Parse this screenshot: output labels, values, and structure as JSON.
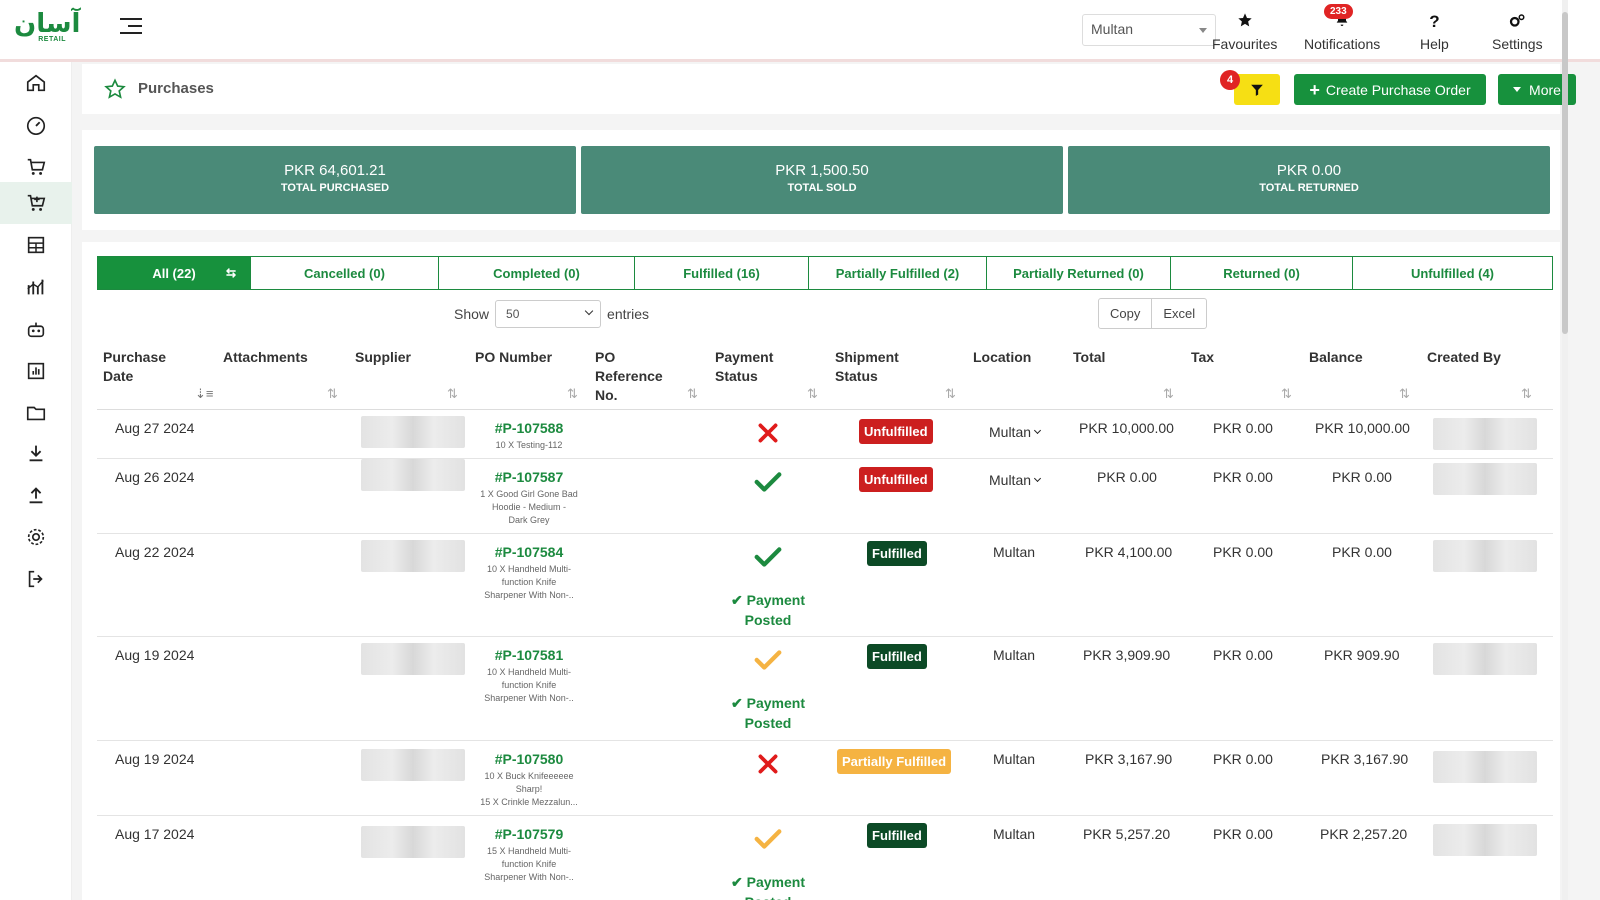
{
  "app": {
    "logo_text": "آسان",
    "logo_sub": "RETAIL"
  },
  "topbar": {
    "location_value": "Multan",
    "nav": [
      {
        "label": "Favourites",
        "icon": "star-icon"
      },
      {
        "label": "Notifications",
        "icon": "bell-icon",
        "badge": "233"
      },
      {
        "label": "Help",
        "icon": "question-icon"
      },
      {
        "label": "Settings",
        "icon": "gears-icon"
      }
    ]
  },
  "sidebar": {
    "items": [
      {
        "name": "home-icon"
      },
      {
        "name": "dashboard-icon"
      },
      {
        "name": "sales-cart-icon"
      },
      {
        "name": "purchases-cart-icon",
        "active": true
      },
      {
        "name": "inventory-icon"
      },
      {
        "name": "reports-chart-icon"
      },
      {
        "name": "bot-icon"
      },
      {
        "name": "analytics-icon"
      },
      {
        "name": "folder-icon"
      },
      {
        "name": "download-icon"
      },
      {
        "name": "upload-icon"
      },
      {
        "name": "gear-icon"
      },
      {
        "name": "logout-icon"
      }
    ]
  },
  "header": {
    "title": "Purchases",
    "filter_badge": "4",
    "create_label": "Create Purchase Order",
    "more_label": "More"
  },
  "stats": [
    {
      "amount": "PKR 64,601.21",
      "label": "TOTAL PURCHASED"
    },
    {
      "amount": "PKR 1,500.50",
      "label": "TOTAL SOLD"
    },
    {
      "amount": "PKR 0.00",
      "label": "TOTAL RETURNED"
    }
  ],
  "tabs": [
    {
      "label": "All (22)",
      "active": true
    },
    {
      "label": "Cancelled (0)"
    },
    {
      "label": "Completed (0)"
    },
    {
      "label": "Fulfilled (16)"
    },
    {
      "label": "Partially Fulfilled (2)"
    },
    {
      "label": "Partially Returned (0)"
    },
    {
      "label": "Returned (0)"
    },
    {
      "label": "Unfulfilled (4)"
    }
  ],
  "table_controls": {
    "show_label": "Show",
    "entries_value": "50",
    "entries_label": "entries",
    "copy_label": "Copy",
    "excel_label": "Excel"
  },
  "columns": [
    "Purchase Date",
    "Attachments",
    "Supplier",
    "PO Number",
    "PO Reference No.",
    "Payment Status",
    "Shipment Status",
    "Location",
    "Total",
    "Tax",
    "Balance",
    "Created By"
  ],
  "rows": [
    {
      "date": "Aug 27 2024",
      "po": "#P-107588",
      "desc": [
        "10 X Testing-112"
      ],
      "payment": "cross",
      "payment_posted": "",
      "shipment": "Unfulfilled",
      "shipment_type": "unfulfilled",
      "location": "Multan",
      "location_dropdown": true,
      "total": "PKR 10,000.00",
      "tax": "PKR 0.00",
      "balance": "PKR 10,000.00"
    },
    {
      "date": "Aug 26 2024",
      "po": "#P-107587",
      "desc": [
        "1 X Good Girl Gone Bad",
        "Hoodie - Medium -",
        "Dark Grey"
      ],
      "payment": "check",
      "payment_posted": "",
      "shipment": "Unfulfilled",
      "shipment_type": "unfulfilled",
      "location": "Multan",
      "location_dropdown": true,
      "total": "PKR 0.00",
      "tax": "PKR 0.00",
      "balance": "PKR 0.00"
    },
    {
      "date": "Aug 22 2024",
      "po": "#P-107584",
      "desc": [
        "10 X Handheld Multi-",
        "function Knife",
        "Sharpener With Non-.."
      ],
      "payment": "check",
      "payment_posted": "Payment Posted",
      "shipment": "Fulfilled",
      "shipment_type": "fulfilled",
      "location": "Multan",
      "location_dropdown": false,
      "total": "PKR 4,100.00",
      "tax": "PKR 0.00",
      "balance": "PKR 0.00"
    },
    {
      "date": "Aug 19 2024",
      "po": "#P-107581",
      "desc": [
        "10 X Handheld Multi-",
        "function Knife",
        "Sharpener With Non-.."
      ],
      "payment": "partial-check",
      "payment_posted": "Payment Posted",
      "shipment": "Fulfilled",
      "shipment_type": "fulfilled",
      "location": "Multan",
      "location_dropdown": false,
      "total": "PKR 3,909.90",
      "tax": "PKR 0.00",
      "balance": "PKR 909.90"
    },
    {
      "date": "Aug 19 2024",
      "po": "#P-107580",
      "desc": [
        "10 X Buck Knifeeeeee",
        "Sharp!",
        "15 X Crinkle Mezzalun..."
      ],
      "payment": "cross",
      "payment_posted": "",
      "shipment": "Partially Fulfilled",
      "shipment_type": "partial",
      "location": "Multan",
      "location_dropdown": false,
      "total": "PKR 3,167.90",
      "tax": "PKR 0.00",
      "balance": "PKR 3,167.90"
    },
    {
      "date": "Aug 17 2024",
      "po": "#P-107579",
      "desc": [
        "15 X Handheld Multi-",
        "function Knife",
        "Sharpener With Non-.."
      ],
      "payment": "partial-check",
      "payment_posted": "Payment Posted",
      "shipment": "Fulfilled",
      "shipment_type": "fulfilled",
      "location": "Multan",
      "location_dropdown": false,
      "total": "PKR 5,257.20",
      "tax": "PKR 0.00",
      "balance": "PKR 2,257.20"
    }
  ],
  "colors": {
    "brand_green": "#17913d",
    "stat_green": "#4a8a78",
    "filter_yellow": "#f6df14",
    "danger_red": "#cc1f1f",
    "fulfilled_dark": "#0c4a26",
    "partial_orange": "#f5b342"
  }
}
